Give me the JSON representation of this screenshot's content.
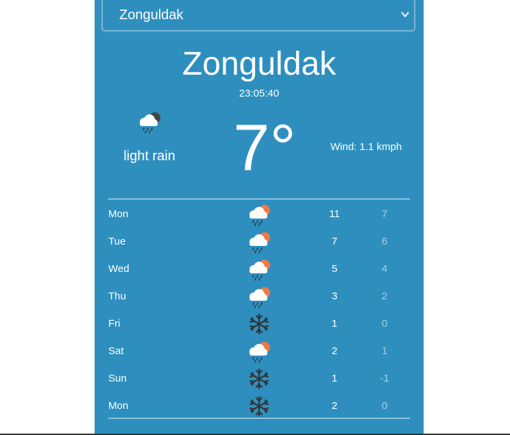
{
  "select": {
    "value": "Zonguldak",
    "icon": "chevron-down-icon"
  },
  "current": {
    "city": "Zonguldak",
    "time": "23:05:40",
    "condition": "light rain",
    "icon": "rain-cloud-night-icon",
    "temperature": "7°",
    "wind": "Wind: 1.1 kmph"
  },
  "forecast": [
    {
      "day": "Mon",
      "icon": "rain-cloud-sun-icon",
      "high": "11",
      "low": "7"
    },
    {
      "day": "Tue",
      "icon": "rain-cloud-sun-icon",
      "high": "7",
      "low": "6"
    },
    {
      "day": "Wed",
      "icon": "rain-cloud-sun-icon",
      "high": "5",
      "low": "4"
    },
    {
      "day": "Thu",
      "icon": "rain-cloud-sun-icon",
      "high": "3",
      "low": "2"
    },
    {
      "day": "Fri",
      "icon": "snowflake-icon",
      "high": "1",
      "low": "0"
    },
    {
      "day": "Sat",
      "icon": "rain-cloud-sun-icon",
      "high": "2",
      "low": "1"
    },
    {
      "day": "Sun",
      "icon": "snowflake-icon",
      "high": "1",
      "low": "-1"
    },
    {
      "day": "Mon",
      "icon": "snowflake-icon",
      "high": "2",
      "low": "0"
    }
  ],
  "colors": {
    "panel": "#2e8fbf",
    "low_temp": "#a6d0e6",
    "sun": "#f07a45",
    "moon": "#444444",
    "snow": "#333333"
  }
}
